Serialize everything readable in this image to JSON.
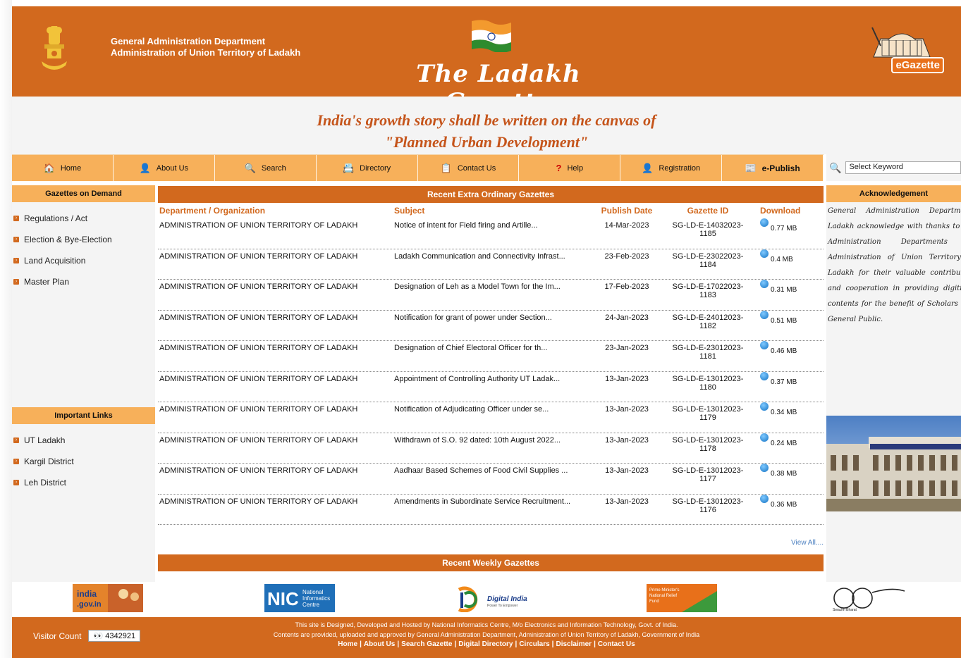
{
  "header": {
    "dept_line1": "General Administration Department",
    "dept_line2": "Administration of Union Territory of Ladakh",
    "title": "The Ladakh Gazette",
    "logo_text": "eGazette"
  },
  "tagline": {
    "line1": "India's growth story shall be written on the canvas of",
    "line2": "\"Planned Urban Development\""
  },
  "nav": [
    {
      "label": "Home",
      "icon": "home-icon"
    },
    {
      "label": "About Us",
      "icon": "user-icon"
    },
    {
      "label": "Search",
      "icon": "search-icon"
    },
    {
      "label": "Directory",
      "icon": "directory-icon"
    },
    {
      "label": "Contact Us",
      "icon": "contact-icon"
    },
    {
      "label": "Help",
      "icon": "help-icon"
    },
    {
      "label": "Registration",
      "icon": "registration-icon"
    },
    {
      "label": "e-Publish",
      "icon": "publish-icon"
    }
  ],
  "search": {
    "selected": "Select Keyword"
  },
  "left": {
    "gazettes_title": "Gazettes on Demand",
    "gazettes": [
      "Regulations / Act",
      "Election & Bye-Election",
      "Land Acquisition",
      "Master Plan"
    ],
    "links_title": "Important Links",
    "links": [
      "UT Ladakh",
      "Kargil District",
      "Leh District"
    ]
  },
  "center": {
    "recent_title": "Recent Extra Ordinary Gazettes",
    "columns": [
      "Department / Organization",
      "Subject",
      "Publish Date",
      "Gazette ID",
      "Download"
    ],
    "rows": [
      {
        "dept": "ADMINISTRATION OF UNION TERRITORY OF LADAKH",
        "subject": "Notice of intent for Field firing and Artille...",
        "date": "14-Mar-2023",
        "id": "SG-LD-E-14032023-1185",
        "size": "0.77 MB"
      },
      {
        "dept": "ADMINISTRATION OF UNION TERRITORY OF LADAKH",
        "subject": "Ladakh Communication and Connectivity Infrast...",
        "date": "23-Feb-2023",
        "id": "SG-LD-E-23022023-1184",
        "size": "0.4 MB"
      },
      {
        "dept": "ADMINISTRATION OF UNION TERRITORY OF LADAKH",
        "subject": "Designation of Leh as a Model Town for the Im...",
        "date": "17-Feb-2023",
        "id": "SG-LD-E-17022023-1183",
        "size": "0.31 MB"
      },
      {
        "dept": "ADMINISTRATION OF UNION TERRITORY OF LADAKH",
        "subject": "Notification for grant of power under Section...",
        "date": "24-Jan-2023",
        "id": "SG-LD-E-24012023-1182",
        "size": "0.51 MB"
      },
      {
        "dept": "ADMINISTRATION OF UNION TERRITORY OF LADAKH",
        "subject": "Designation of Chief Electoral Officer for th...",
        "date": "23-Jan-2023",
        "id": "SG-LD-E-23012023-1181",
        "size": "0.46 MB"
      },
      {
        "dept": "ADMINISTRATION OF UNION TERRITORY OF LADAKH",
        "subject": "Appointment of Controlling Authority UT Ladak...",
        "date": "13-Jan-2023",
        "id": "SG-LD-E-13012023-1180",
        "size": "0.37 MB"
      },
      {
        "dept": "ADMINISTRATION OF UNION TERRITORY OF LADAKH",
        "subject": "Notification of Adjudicating Officer under se...",
        "date": "13-Jan-2023",
        "id": "SG-LD-E-13012023-1179",
        "size": "0.34 MB"
      },
      {
        "dept": "ADMINISTRATION OF UNION TERRITORY OF LADAKH",
        "subject": "Withdrawn of S.O. 92 dated: 10th August 2022...",
        "date": "13-Jan-2023",
        "id": "SG-LD-E-13012023-1178",
        "size": "0.24 MB"
      },
      {
        "dept": "ADMINISTRATION OF UNION TERRITORY OF LADAKH",
        "subject": "Aadhaar Based Schemes of Food Civil Supplies ...",
        "date": "13-Jan-2023",
        "id": "SG-LD-E-13012023-1177",
        "size": "0.38 MB"
      },
      {
        "dept": "ADMINISTRATION OF UNION TERRITORY OF LADAKH",
        "subject": "Amendments in Subordinate Service Recruitment...",
        "date": "13-Jan-2023",
        "id": "SG-LD-E-13012023-1176",
        "size": "0.36 MB"
      }
    ],
    "view_all": "View All....",
    "weekly_title": "Recent Weekly Gazettes"
  },
  "right": {
    "ack_title": "Acknowledgement",
    "ack_text": "General Administration Department, Ladakh acknowledge with thanks to the Administration Departments of Administration of Union Territory of Ladakh for their valuable contribution and cooperation in providing digitized contents for the benefit of Scholars and General Public."
  },
  "partners": {
    "india_gov": "india.gov.in",
    "nic": "National Informatics Centre",
    "digital_india": "Digital India",
    "pmnrf": "Prime Minister's National Relief Fund",
    "swachh": "Swachh Bharat"
  },
  "footer": {
    "visitor_label": "Visitor Count",
    "visitor_count": "4342921",
    "line1": "This site is Designed, Developed and Hosted by National Informatics Centre, M/o Electronics and Information Technology, Govt. of India.",
    "line2": "Contents are provided, uploaded and approved by General Administration Department, Administration of Union Territory of Ladakh, Government of India",
    "links": [
      "Home",
      "About Us",
      "Search Gazette",
      "Digital Directory",
      "Circulars",
      "Disclaimer",
      "Contact Us"
    ]
  },
  "colors": {
    "brand": "#d2691e",
    "nav": "#f7b05a",
    "title": "#c5541a"
  }
}
